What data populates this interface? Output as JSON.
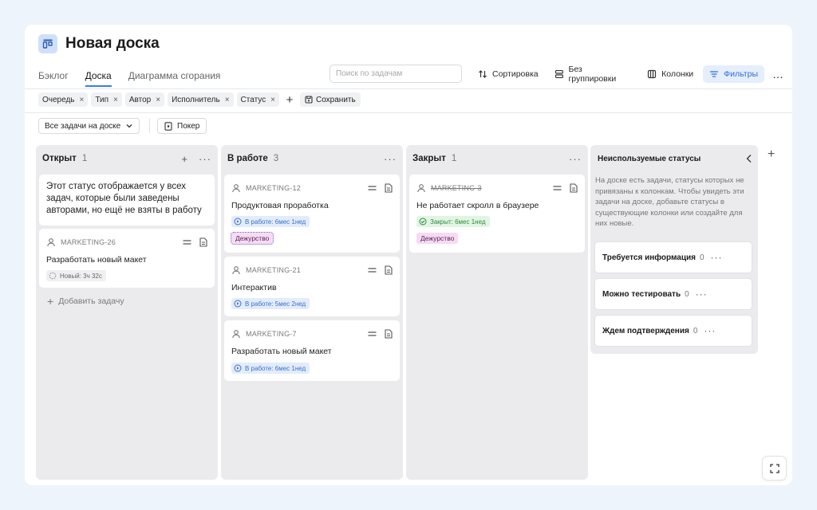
{
  "header": {
    "title": "Новая доска"
  },
  "tabs": [
    {
      "label": "Бэклог"
    },
    {
      "label": "Доска"
    },
    {
      "label": "Диаграмма сгорания"
    }
  ],
  "search": {
    "placeholder": "Поиск по задачам"
  },
  "toolbar": {
    "sort_label": "Сортировка",
    "grouping_label": "Без группировки",
    "columns_label": "Колонки",
    "filters_label": "Фильтры",
    "more": "…"
  },
  "filters": {
    "chips": [
      {
        "label": "Очередь"
      },
      {
        "label": "Тип"
      },
      {
        "label": "Автор"
      },
      {
        "label": "Исполнитель"
      },
      {
        "label": "Статус"
      }
    ],
    "remove_glyph": "×",
    "add_glyph": "+",
    "save_label": "Сохранить"
  },
  "scope_select": {
    "value": "Все задачи на доске"
  },
  "poker_label": "Покер",
  "columns": [
    {
      "title": "Открыт",
      "count": "1",
      "note": "Этот статус отображается у всех задач, которые были заведены авторами, но ещё не взяты в работу",
      "cards": [
        {
          "key": "MARKETING-26",
          "name": "Разработать новый макет",
          "badge": "Новый: 3ч 32с"
        }
      ],
      "add_task": "Добавить задачу"
    },
    {
      "title": "В работе",
      "count": "3",
      "cards": [
        {
          "key": "MARKETING-12",
          "name": "Продуктовая проработка",
          "badge": "В работе: 6мес 1нед",
          "tag": "Дежурство"
        },
        {
          "key": "MARKETING-21",
          "name": "Интерактив",
          "badge": "В работе: 5мес 2нед"
        },
        {
          "key": "MARKETING-7",
          "name": "Разработать новый макет",
          "badge": "В работе: 6мес 1нед"
        }
      ]
    },
    {
      "title": "Закрыт",
      "count": "1",
      "cards": [
        {
          "key": "MARKETING-3",
          "name": "Не работает скролл в браузере",
          "badge": "Закрыт: 6мес 1нед",
          "tag": "Дежурство"
        }
      ]
    }
  ],
  "unused": {
    "title": "Неиспользуемые статусы",
    "description": "На доске есть задачи, статусы которых не привязаны к колонкам. Чтобы увидеть эти задачи на доске, добавьте статусы в существующие колонки или создайте для них новые.",
    "statuses": [
      {
        "name": "Требуется информация",
        "count": "0"
      },
      {
        "name": "Можно тестировать",
        "count": "0"
      },
      {
        "name": "Ждем подтверждения",
        "count": "0"
      }
    ]
  },
  "colors": {
    "accent": "#3d7be8",
    "accent_bg": "#e5eefc",
    "tag_bg": "#f6dbf4",
    "status_blue": "#3a6fcf",
    "status_green": "#2f8a3d",
    "column_bg": "#ebebed",
    "page_bg": "#eef4fb"
  },
  "icons": {
    "board": "board-icon",
    "sort": "sort-arrows-icon",
    "grouping": "grouping-icon",
    "columns": "columns-icon",
    "filters": "filter-icon",
    "save": "save-icon",
    "poker": "card-icon",
    "user": "user-icon",
    "drag": "drag-handle-icon",
    "doc": "document-icon",
    "fullscreen": "fullscreen-icon"
  }
}
